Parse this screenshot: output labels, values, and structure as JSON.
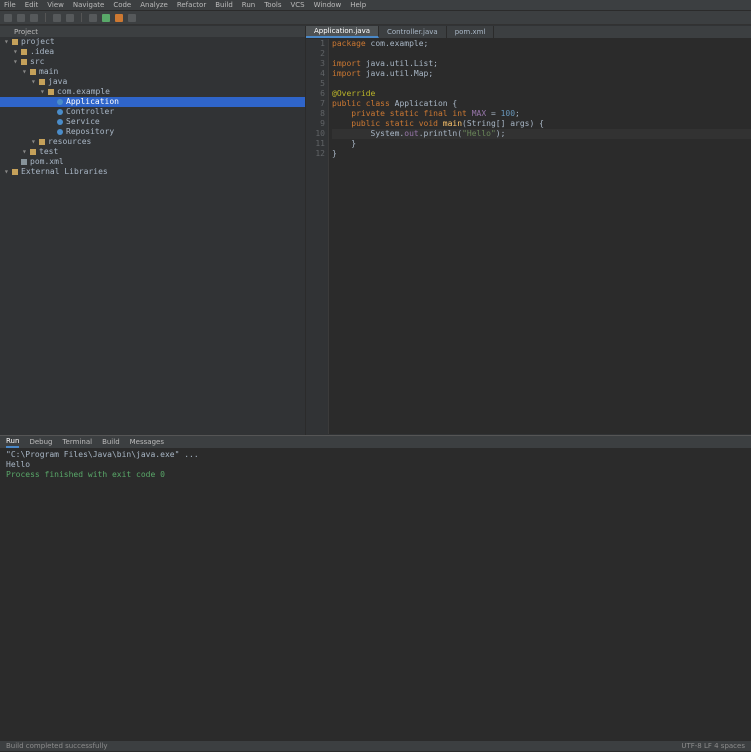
{
  "menu": [
    "File",
    "Edit",
    "View",
    "Navigate",
    "Code",
    "Analyze",
    "Refactor",
    "Build",
    "Run",
    "Tools",
    "VCS",
    "Window",
    "Help"
  ],
  "project": {
    "header": "Project",
    "rows": [
      {
        "indent": 0,
        "kind": "folder",
        "label": "project",
        "mod": ""
      },
      {
        "indent": 1,
        "kind": "folder",
        "label": ".idea",
        "mod": ""
      },
      {
        "indent": 1,
        "kind": "folder",
        "label": "src",
        "mod": ""
      },
      {
        "indent": 2,
        "kind": "folder",
        "label": "main",
        "mod": ""
      },
      {
        "indent": 3,
        "kind": "folder",
        "label": "java",
        "mod": ""
      },
      {
        "indent": 4,
        "kind": "folder",
        "label": "com.example",
        "mod": ""
      },
      {
        "indent": 5,
        "kind": "java",
        "label": "Application",
        "mod": ""
      },
      {
        "indent": 5,
        "kind": "java",
        "label": "Controller",
        "mod": ""
      },
      {
        "indent": 5,
        "kind": "java",
        "label": "Service",
        "mod": ""
      },
      {
        "indent": 5,
        "kind": "java",
        "label": "Repository",
        "mod": ""
      },
      {
        "indent": 3,
        "kind": "folder",
        "label": "resources",
        "mod": ""
      },
      {
        "indent": 2,
        "kind": "folder",
        "label": "test",
        "mod": ""
      },
      {
        "indent": 1,
        "kind": "file",
        "label": "pom.xml",
        "mod": ""
      },
      {
        "indent": 0,
        "kind": "folder",
        "label": "External Libraries",
        "mod": ""
      }
    ],
    "selected_index": 6
  },
  "tabs": [
    {
      "label": "Application.java",
      "active": true
    },
    {
      "label": "Controller.java",
      "active": false
    },
    {
      "label": "pom.xml",
      "active": false
    }
  ],
  "editor": {
    "lines": [
      [
        {
          "t": "package ",
          "c": "kw"
        },
        {
          "t": "com.example;",
          "c": ""
        }
      ],
      [
        {
          "t": "",
          "c": ""
        }
      ],
      [
        {
          "t": "import ",
          "c": "kw"
        },
        {
          "t": "java.util.List;",
          "c": ""
        }
      ],
      [
        {
          "t": "import ",
          "c": "kw"
        },
        {
          "t": "java.util.Map;",
          "c": ""
        }
      ],
      [
        {
          "t": "",
          "c": ""
        }
      ],
      [
        {
          "t": "@Override",
          "c": "ann"
        }
      ],
      [
        {
          "t": "public class ",
          "c": "kw"
        },
        {
          "t": "Application ",
          "c": ""
        },
        {
          "t": "{",
          "c": ""
        }
      ],
      [
        {
          "t": "    private static final ",
          "c": "kw"
        },
        {
          "t": "int ",
          "c": "kw"
        },
        {
          "t": "MAX",
          "c": "fld"
        },
        {
          "t": " = ",
          "c": ""
        },
        {
          "t": "100",
          "c": "num"
        },
        {
          "t": ";",
          "c": ""
        }
      ],
      [
        {
          "t": "    public static void ",
          "c": "kw"
        },
        {
          "t": "main",
          "c": "fn"
        },
        {
          "t": "(String[] args) {",
          "c": ""
        }
      ],
      [
        {
          "t": "        System.",
          "c": ""
        },
        {
          "t": "out",
          "c": "fld"
        },
        {
          "t": ".println(",
          "c": ""
        },
        {
          "t": "\"Hello\"",
          "c": "str"
        },
        {
          "t": ");",
          "c": ""
        }
      ],
      [
        {
          "t": "    }",
          "c": ""
        }
      ],
      [
        {
          "t": "}",
          "c": ""
        }
      ]
    ],
    "current_line": 9
  },
  "bottom": {
    "tabs": [
      "Run",
      "Debug",
      "Terminal",
      "Build",
      "Messages"
    ],
    "active_tab": "Run",
    "log": [
      {
        "c": "info",
        "t": "\"C:\\Program Files\\Java\\bin\\java.exe\" ..."
      },
      {
        "c": "info",
        "t": "Hello"
      },
      {
        "c": "ok",
        "t": "Process finished with exit code 0"
      }
    ]
  },
  "status": {
    "left": "Build completed successfully",
    "right": "UTF-8   LF   4 spaces"
  }
}
